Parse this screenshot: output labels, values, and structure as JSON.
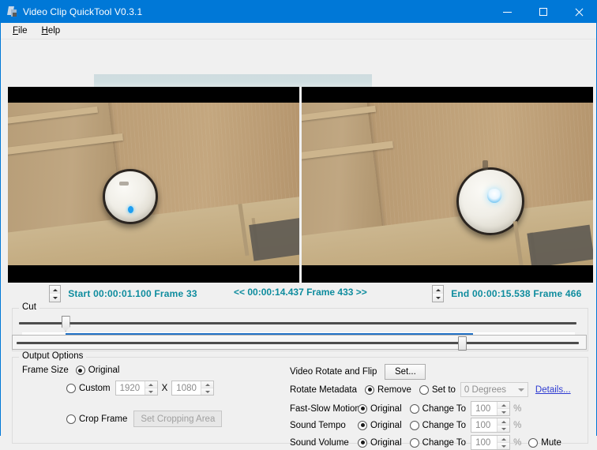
{
  "window": {
    "title": "Video Clip QuickTool V0.3.1",
    "icon": "video-clip-app-icon",
    "accent_color": "#0078d7",
    "background_color": "#f0f0f0",
    "controls": {
      "minimize": "minimize-icon",
      "maximize": "maximize-icon",
      "close": "close-icon"
    }
  },
  "menubar": {
    "items": [
      {
        "label": "File",
        "accelerator": "F"
      },
      {
        "label": "Help",
        "accelerator": "H"
      }
    ]
  },
  "preview": {
    "left": {
      "name": "start-frame-preview",
      "caption": "Start frame preview"
    },
    "right": {
      "name": "end-frame-preview",
      "caption": "End frame preview"
    }
  },
  "timeline": {
    "accent_color": "#0e8c9e",
    "start": {
      "label": "Start 00:00:01.100  Frame 33",
      "time": "00:00:01.100",
      "frame": "Frame 33"
    },
    "current": {
      "label": "<< 00:00:14.437  Frame 433 >>",
      "time": "00:00:14.437",
      "frame": "Frame 433"
    },
    "end": {
      "label": "End 00:00:15.538  Frame 466",
      "time": "00:00:15.538",
      "frame": "Frame 466"
    }
  },
  "cut": {
    "caption": "Cut",
    "start_slider_pct": 7.7,
    "end_slider_pct": 79.5,
    "progress_start_pct": 7.7,
    "progress_end_pct": 81.6,
    "progress_color": "#2272c6"
  },
  "output_options": {
    "caption": "Output Options",
    "frame_size": {
      "label": "Frame Size",
      "original": {
        "label": "Original",
        "selected": true
      },
      "custom": {
        "label": "Custom",
        "selected": false,
        "width": "1920",
        "separator": "X",
        "height": "1080"
      },
      "crop": {
        "label": "Crop Frame",
        "selected": false,
        "button": "Set Cropping Area",
        "button_enabled": false
      }
    },
    "rotate_flip": {
      "label": "Video Rotate and Flip",
      "button": "Set..."
    },
    "rotate_metadata": {
      "label": "Rotate Metadata",
      "remove": {
        "label": "Remove",
        "selected": true
      },
      "set_to": {
        "label": "Set to",
        "selected": false
      },
      "degrees_value": "0 Degrees",
      "degrees_enabled": false,
      "details_link": "Details...",
      "link_color": "#2d3ad1"
    },
    "fast_slow_motion": {
      "label": "Fast-Slow Motion",
      "original": {
        "label": "Original",
        "selected": true
      },
      "change_to": {
        "label": "Change To",
        "selected": false
      },
      "value": "100",
      "unit": "%"
    },
    "sound_tempo": {
      "label": "Sound Tempo",
      "original": {
        "label": "Original",
        "selected": true
      },
      "change_to": {
        "label": "Change To",
        "selected": false
      },
      "value": "100",
      "unit": "%"
    },
    "sound_volume": {
      "label": "Sound Volume",
      "original": {
        "label": "Original",
        "selected": true
      },
      "change_to": {
        "label": "Change To",
        "selected": false
      },
      "value": "100",
      "unit": "%",
      "mute": {
        "label": "Mute",
        "selected": false
      }
    }
  }
}
